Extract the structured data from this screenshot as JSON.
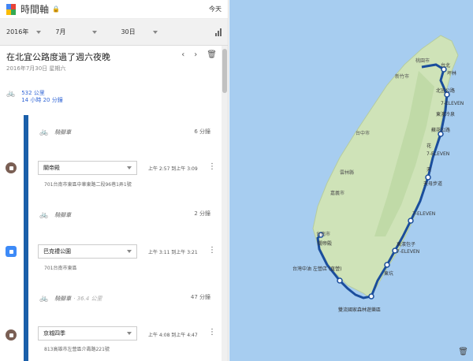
{
  "app": {
    "title": "時間軸",
    "today": "今天"
  },
  "datebar": {
    "year": "2016年",
    "month": "7月",
    "day": "30日"
  },
  "header": {
    "title": "在北宜公路度過了週六夜晚",
    "date": "2016年7月30日 星期六"
  },
  "summary": {
    "distance": "532 公里",
    "duration": "14 小時 20 分鐘"
  },
  "segments": [
    {
      "kind": "activity",
      "label": "騎腳車",
      "duration": "6 分鐘"
    },
    {
      "kind": "place",
      "icon": "stop",
      "name": "關帝殿",
      "time": "上午 2:57 到上午 3:09",
      "address": "701台南市東區中華東路二段96巷1弄1號"
    },
    {
      "kind": "activity",
      "label": "騎腳車",
      "duration": "2 分鐘"
    },
    {
      "kind": "place",
      "icon": "bus",
      "name": "巴克禮公園",
      "time": "上午 3:11 到上午 3:21",
      "address": "701台南市東區"
    },
    {
      "kind": "activity",
      "label": "騎腳車",
      "extra": "· 36.4 公里",
      "duration": "47 分鐘"
    },
    {
      "kind": "place",
      "icon": "stop",
      "name": "京城四季",
      "time": "上午 4:08 到上午 4:47",
      "address": "813高雄市左營區介壽路221號"
    }
  ],
  "colors": {
    "route": "#1a4d9c",
    "sea": "#a7cdf0",
    "land": "#cfe3b8",
    "accent": "#3367d6"
  },
  "map": {
    "labels": {
      "taipei": "台北",
      "taoyuan": "桃園市",
      "hsinchu": "新竹市",
      "taichung": "台中市",
      "yunlin": "雲林縣",
      "chiayi": "嘉義市",
      "tainan": "台南市",
      "gds": "關帝殿",
      "kaohsiung": "台灣中油 左營店 (直營)",
      "pingtung": "雙流國家森林遊樂區",
      "fangliao": "東坑",
      "taitung": "東濱包子",
      "s711a": "7-ELEVEN",
      "s711b": "7-ELEVEN",
      "s711c": "7-ELEVEN",
      "s711d": "7-ELEVEN",
      "tianmu": "天母步道",
      "hualien": "花",
      "suao": "蘇花公路",
      "dongao": "東澳冷泉",
      "beiyi": "北宜公路",
      "pinglin": "坪林",
      "tian": "天"
    }
  }
}
